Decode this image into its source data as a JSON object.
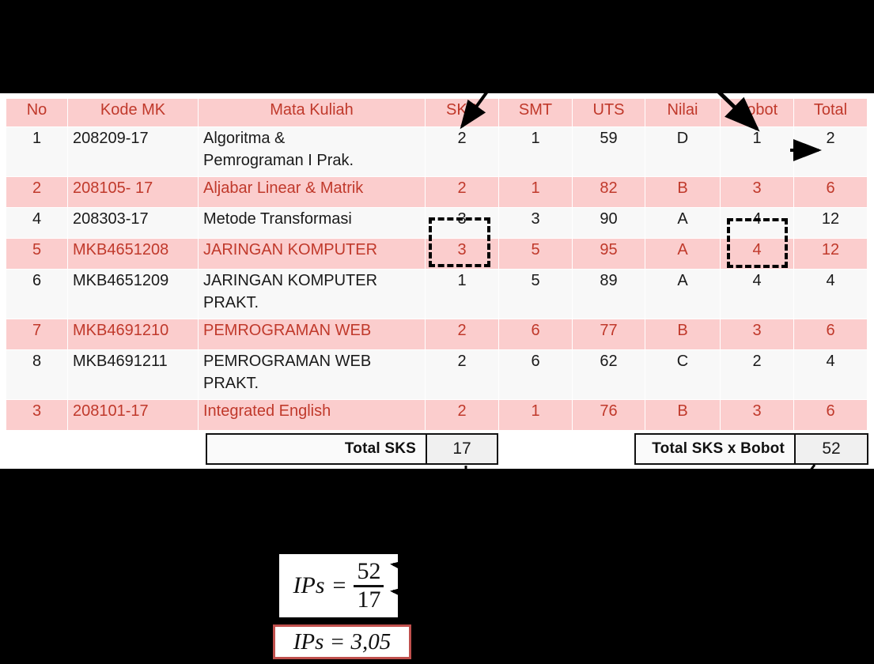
{
  "table": {
    "headers": [
      "No",
      "Kode MK",
      "Mata Kuliah",
      "SKS",
      "SMT",
      "UTS",
      "Nilai",
      "Bobot",
      "Total"
    ],
    "rows": [
      {
        "no": "1",
        "kode": "208209-17",
        "mk": "Algoritma &\nPemrograman I Prak.",
        "sks": "2",
        "smt": "1",
        "uts": "59",
        "nilai": "D",
        "bobot": "1",
        "total": "2",
        "shade": "light",
        "tall": true
      },
      {
        "no": "2",
        "kode": "208105- 17",
        "mk": "Aljabar Linear & Matrik",
        "sks": "2",
        "smt": "1",
        "uts": "82",
        "nilai": "B",
        "bobot": "3",
        "total": "6",
        "shade": "pink",
        "tall": false
      },
      {
        "no": "4",
        "kode": "208303-17",
        "mk": "Metode Transformasi",
        "sks": "3",
        "smt": "3",
        "uts": "90",
        "nilai": "A",
        "bobot": "4",
        "total": "12",
        "shade": "light",
        "tall": false
      },
      {
        "no": "5",
        "kode": "MKB4651208",
        "mk": "JARINGAN  KOMPUTER",
        "sks": "3",
        "smt": "5",
        "uts": "95",
        "nilai": "A",
        "bobot": "4",
        "total": "12",
        "shade": "pink",
        "tall": false
      },
      {
        "no": "6",
        "kode": "MKB4651209",
        "mk": "JARINGAN  KOMPUTER\nPRAKT.",
        "sks": "1",
        "smt": "5",
        "uts": "89",
        "nilai": "A",
        "bobot": "4",
        "total": "4",
        "shade": "light",
        "tall": true
      },
      {
        "no": "7",
        "kode": "MKB4691210",
        "mk": "PEMROGRAMAN WEB",
        "sks": "2",
        "smt": "6",
        "uts": "77",
        "nilai": "B",
        "bobot": "3",
        "total": "6",
        "shade": "pink",
        "tall": false
      },
      {
        "no": "8",
        "kode": "MKB4691211",
        "mk": "PEMROGRAMAN WEB\nPRAKT.",
        "sks": "2",
        "smt": "6",
        "uts": "62",
        "nilai": "C",
        "bobot": "2",
        "total": "4",
        "shade": "light",
        "tall": true
      },
      {
        "no": "3",
        "kode": "208101-17",
        "mk": "Integrated English",
        "sks": "2",
        "smt": "1",
        "uts": "76",
        "nilai": "B",
        "bobot": "3",
        "total": "6",
        "shade": "pink",
        "tall": false
      }
    ]
  },
  "totals": {
    "sks_label": "Total  SKS",
    "sks_value": "17",
    "sks_bobot_label": "Total  SKS x Bobot",
    "sks_bobot_value": "52"
  },
  "formula": {
    "lhs": "IPs",
    "equals": "=",
    "numerator": "52",
    "denominator": "17",
    "result_text": "IPs = 3,05"
  },
  "colors": {
    "header_bg": "#fbcdcd",
    "header_text": "#c0392b",
    "row_pink_bg": "#fbcdcd",
    "row_pink_text": "#c0392b",
    "row_light_bg": "#f8f8f8",
    "row_light_text": "#1a1a1a",
    "annotation": "#000000",
    "result_border": "#c0504d",
    "slide_bg": "#ffffff",
    "page_bg": "#000000"
  }
}
